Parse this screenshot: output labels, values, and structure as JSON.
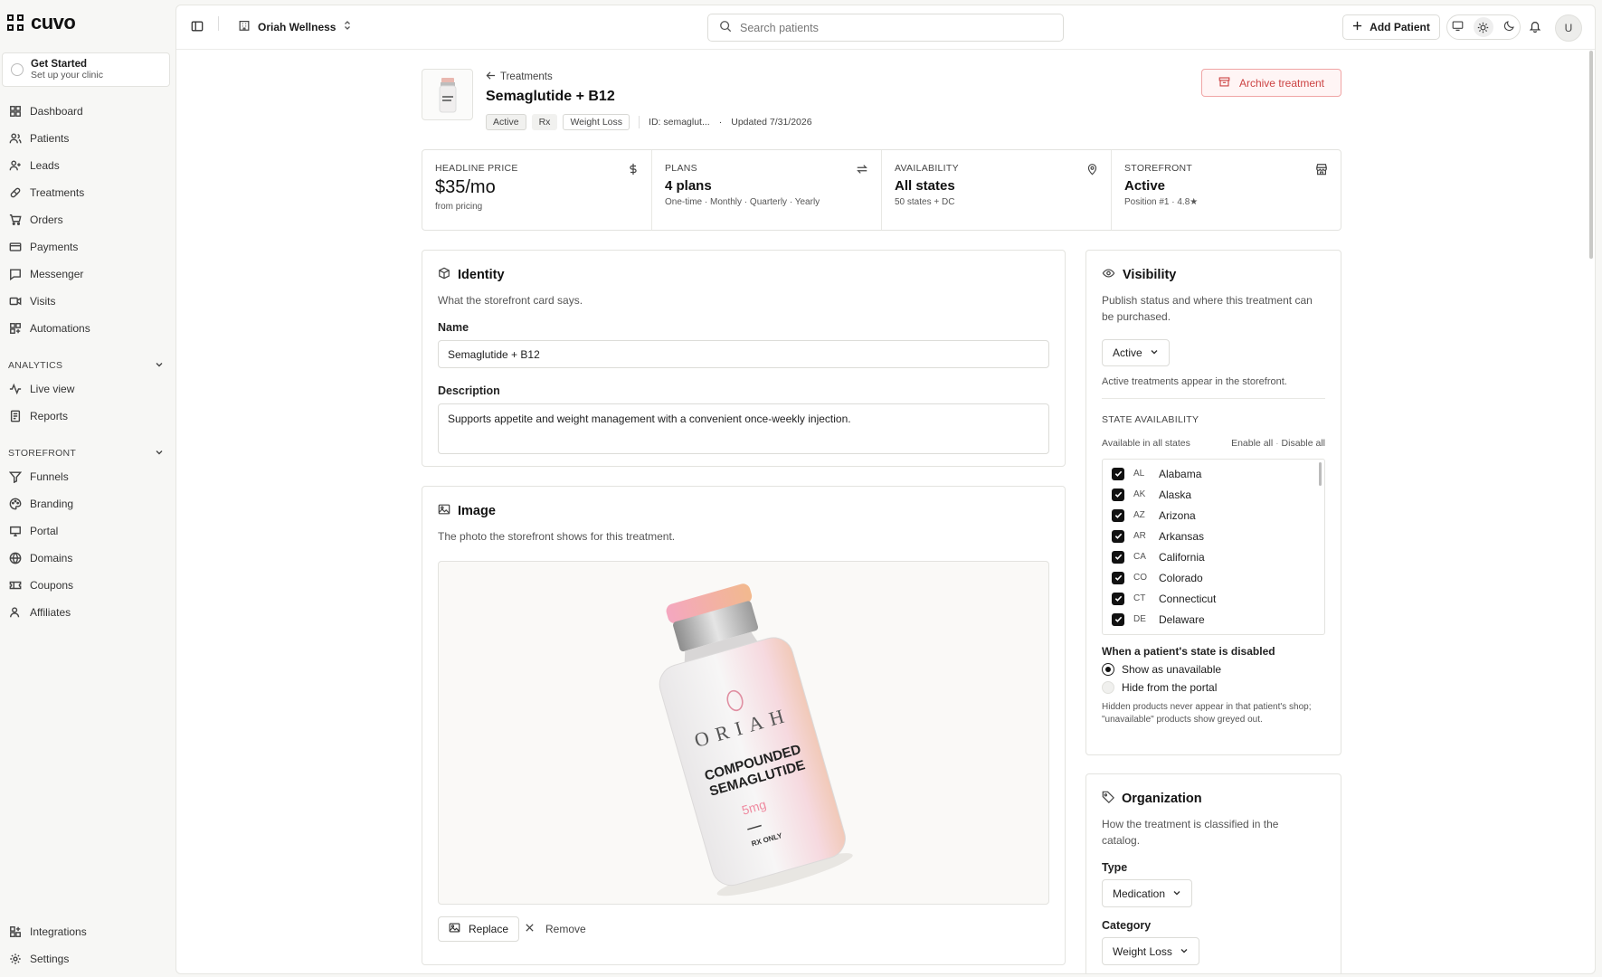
{
  "brand": {
    "name": "cuvo"
  },
  "get_started": {
    "title": "Get Started",
    "subtitle": "Set up your clinic"
  },
  "nav": {
    "main": [
      {
        "label": "Dashboard",
        "icon": "dashboard-icon"
      },
      {
        "label": "Patients",
        "icon": "users-icon"
      },
      {
        "label": "Leads",
        "icon": "user-plus-icon"
      },
      {
        "label": "Treatments",
        "icon": "pill-icon"
      },
      {
        "label": "Orders",
        "icon": "cart-icon"
      },
      {
        "label": "Payments",
        "icon": "credit-card-icon"
      },
      {
        "label": "Messenger",
        "icon": "message-icon"
      },
      {
        "label": "Visits",
        "icon": "video-icon"
      },
      {
        "label": "Automations",
        "icon": "automation-icon"
      }
    ],
    "analytics_label": "ANALYTICS",
    "analytics": [
      {
        "label": "Live view",
        "icon": "activity-icon"
      },
      {
        "label": "Reports",
        "icon": "report-icon"
      }
    ],
    "storefront_label": "STOREFRONT",
    "storefront": [
      {
        "label": "Funnels",
        "icon": "funnel-icon"
      },
      {
        "label": "Branding",
        "icon": "palette-icon"
      },
      {
        "label": "Portal",
        "icon": "portal-icon"
      },
      {
        "label": "Domains",
        "icon": "globe-icon"
      },
      {
        "label": "Coupons",
        "icon": "ticket-icon"
      },
      {
        "label": "Affiliates",
        "icon": "affiliate-icon"
      }
    ],
    "bottom": [
      {
        "label": "Integrations",
        "icon": "integrations-icon"
      },
      {
        "label": "Settings",
        "icon": "gear-icon"
      }
    ]
  },
  "topbar": {
    "org_name": "Oriah Wellness",
    "search_placeholder": "Search patients",
    "add_patient": "Add Patient",
    "avatar": "U"
  },
  "header": {
    "breadcrumb": "Treatments",
    "title": "Semaglutide + B12",
    "tags": [
      "Active",
      "Rx",
      "Weight Loss"
    ],
    "id_text": "ID: semaglut...",
    "dot": "·",
    "updated": "Updated 7/31/2026",
    "archive_label": "Archive treatment"
  },
  "stats": [
    {
      "label": "HEADLINE PRICE",
      "value": "$35/mo",
      "sub": "from pricing",
      "icon": "dollar-icon"
    },
    {
      "label": "PLANS",
      "value": "4 plans",
      "sub": "One-time · Monthly · Quarterly · Yearly",
      "icon": "repeat-icon"
    },
    {
      "label": "AVAILABILITY",
      "value": "All states",
      "sub": "50 states + DC",
      "icon": "map-pin-icon"
    },
    {
      "label": "STOREFRONT",
      "value": "Active",
      "sub": "Position #1 · 4.8★",
      "icon": "store-icon"
    }
  ],
  "identity": {
    "title": "Identity",
    "desc": "What the storefront card says.",
    "name_label": "Name",
    "name_value": "Semaglutide + B12",
    "desc_label": "Description",
    "desc_value": "Supports appetite and weight management with a convenient once-weekly injection."
  },
  "image": {
    "title": "Image",
    "desc": "The photo the storefront shows for this treatment.",
    "vial_brand": "ORIAH",
    "vial_line1": "COMPOUNDED",
    "vial_line2": "SEMAGLUTIDE",
    "vial_dose": "5mg",
    "vial_rx": "RX ONLY",
    "replace": "Replace",
    "remove": "Remove"
  },
  "visibility": {
    "title": "Visibility",
    "desc": "Publish status and where this treatment can be purchased.",
    "status": "Active",
    "status_note": "Active treatments appear in the storefront.",
    "state_label": "STATE AVAILABILITY",
    "available_text": "Available in all states",
    "enable_all": "Enable all",
    "dot": "·",
    "disable_all": "Disable all",
    "states": [
      {
        "abbr": "AL",
        "name": "Alabama"
      },
      {
        "abbr": "AK",
        "name": "Alaska"
      },
      {
        "abbr": "AZ",
        "name": "Arizona"
      },
      {
        "abbr": "AR",
        "name": "Arkansas"
      },
      {
        "abbr": "CA",
        "name": "California"
      },
      {
        "abbr": "CO",
        "name": "Colorado"
      },
      {
        "abbr": "CT",
        "name": "Connecticut"
      },
      {
        "abbr": "DE",
        "name": "Delaware"
      }
    ],
    "disabled_label": "When a patient's state is disabled",
    "opt_show": "Show as unavailable",
    "opt_hide": "Hide from the portal",
    "hint": "Hidden products never appear in that patient's shop; \"unavailable\" products show greyed out."
  },
  "organization": {
    "title": "Organization",
    "desc": "How the treatment is classified in the catalog.",
    "type_label": "Type",
    "type_value": "Medication",
    "category_label": "Category",
    "category_value": "Weight Loss"
  },
  "colors": {
    "accent": "#111111",
    "danger": "#cc4444",
    "border": "#e3e3df"
  }
}
